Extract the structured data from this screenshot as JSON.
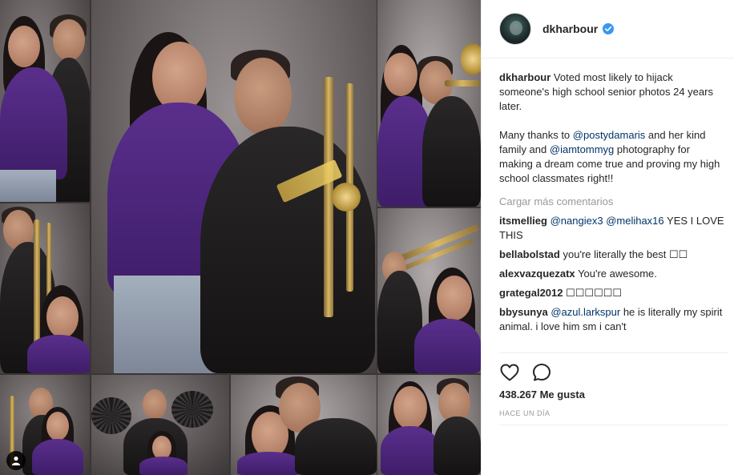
{
  "post": {
    "username": "dkharbour",
    "verified": true,
    "caption": {
      "username": "dkharbour",
      "line1": "Voted most likely to hijack someone's high school senior photos 24 years later.",
      "p2_before": "Many thanks to ",
      "mention1": "@postydamaris",
      "p2_mid": " and her kind family and ",
      "mention2": "@iamtommyg",
      "p2_after": " photography for making a dream come true and proving my high school classmates right!!"
    },
    "load_more": "Cargar más comentarios",
    "comments": [
      {
        "user": "itsmellieg",
        "mention1": "@nangiex3",
        "mention2": "@melihax16",
        "text": " YES I LOVE THIS"
      },
      {
        "user": "bellabolstad",
        "text": "you're literally the best ☐☐"
      },
      {
        "user": "alexvazquezatx",
        "text": "You're awesome."
      },
      {
        "user": "grategal2012",
        "text": "☐☐☐☐☐☐"
      },
      {
        "user": "bbysunya",
        "mention1": "@azul.larkspur",
        "text": " he is literally my spirit animal. i love him sm i can't"
      }
    ],
    "likes": "438.267 Me gusta",
    "time": "HACE UN DÍA"
  },
  "icons": {
    "heart": "heart-icon",
    "comment": "comment-icon",
    "verified": "verified-badge-icon",
    "user": "user-tag-icon"
  },
  "colors": {
    "link": "#003569",
    "muted": "#999999",
    "verified": "#3897f0",
    "divider": "#efefef"
  }
}
